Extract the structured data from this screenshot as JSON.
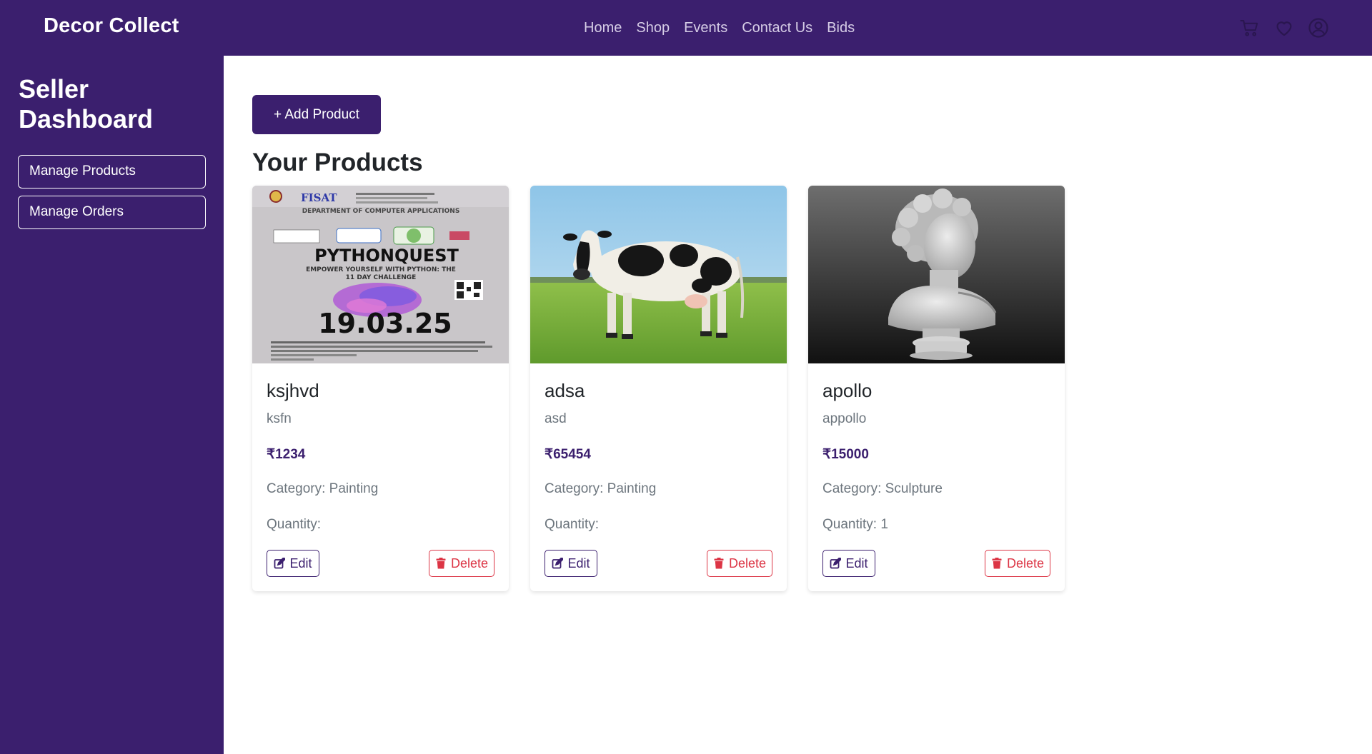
{
  "header": {
    "brand": "Decor Collect",
    "nav": [
      "Home",
      "Shop",
      "Events",
      "Contact Us",
      "Bids"
    ],
    "icons": [
      "cart-icon",
      "heart-icon",
      "user-icon"
    ]
  },
  "sidebar": {
    "title": "Seller Dashboard",
    "items": [
      {
        "label": "Manage Products"
      },
      {
        "label": "Manage Orders"
      }
    ]
  },
  "main": {
    "add_button": "+ Add Product",
    "section_title": "Your Products",
    "products": [
      {
        "name": "ksjhvd",
        "description": "ksfn",
        "price": "₹1234",
        "category": "Category: Painting",
        "quantity": "Quantity:",
        "edit_label": "Edit",
        "delete_label": "Delete",
        "poster": {
          "org": "FISAT",
          "dept": "DEPARTMENT OF COMPUTER APPLICATIONS",
          "title": "PYTHONQUEST",
          "subtitle": "EMPOWER YOURSELF WITH PYTHON: THE",
          "subtitle2": "11 DAY CHALLENGE",
          "date": "19.03.25"
        }
      },
      {
        "name": "adsa",
        "description": "asd",
        "price": "₹65454",
        "category": "Category: Painting",
        "quantity": "Quantity:",
        "edit_label": "Edit",
        "delete_label": "Delete"
      },
      {
        "name": "apollo",
        "description": "appollo",
        "price": "₹15000",
        "category": "Category: Sculpture",
        "quantity": "Quantity: 1",
        "edit_label": "Edit",
        "delete_label": "Delete"
      }
    ]
  },
  "colors": {
    "primary": "#3b1f6e",
    "danger": "#dc3545",
    "price": "#3b1f6e"
  }
}
